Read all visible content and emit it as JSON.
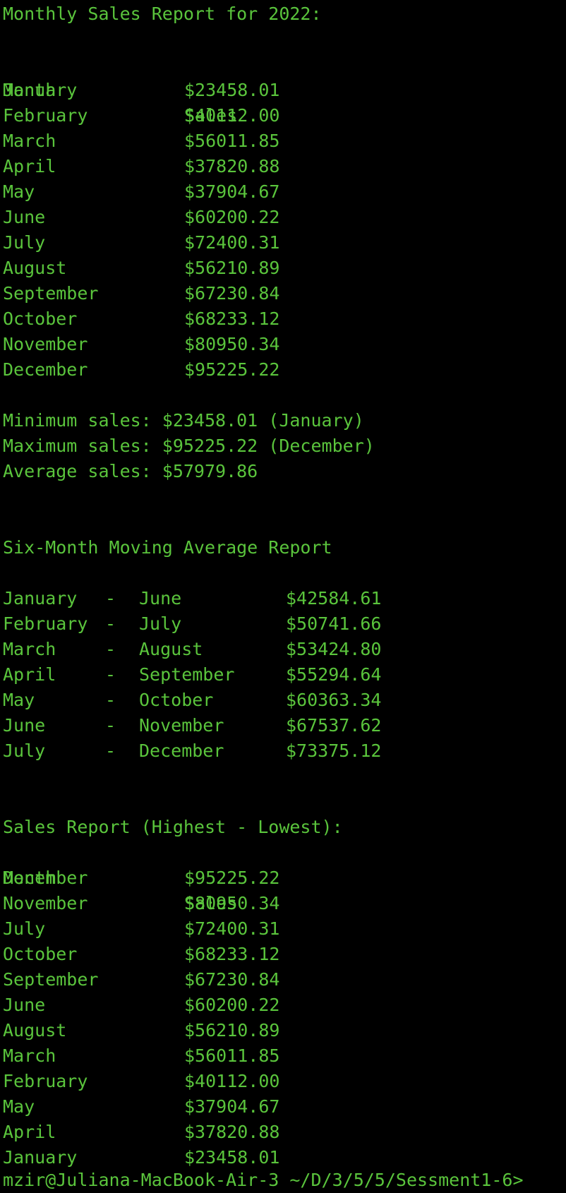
{
  "colors": {
    "background": "#000000",
    "text": "#5ac43c"
  },
  "monthly": {
    "title": "Monthly Sales Report for 2022:",
    "header_month": "Month",
    "header_sales": "Sales",
    "rows": [
      {
        "month": "January",
        "sales": "$23458.01"
      },
      {
        "month": "February",
        "sales": "$40112.00"
      },
      {
        "month": "March",
        "sales": "$56011.85"
      },
      {
        "month": "April",
        "sales": "$37820.88"
      },
      {
        "month": "May",
        "sales": "$37904.67"
      },
      {
        "month": "June",
        "sales": "$60200.22"
      },
      {
        "month": "July",
        "sales": "$72400.31"
      },
      {
        "month": "August",
        "sales": "$56210.89"
      },
      {
        "month": "September",
        "sales": "$67230.84"
      },
      {
        "month": "October",
        "sales": "$68233.12"
      },
      {
        "month": "November",
        "sales": "$80950.34"
      },
      {
        "month": "December",
        "sales": "$95225.22"
      }
    ],
    "min_line": "Minimum sales: $23458.01 (January)",
    "max_line": "Maximum sales: $95225.22 (December)",
    "avg_line": "Average sales: $57979.86"
  },
  "moving_average": {
    "title": "Six-Month Moving Average Report",
    "rows": [
      {
        "start": "January",
        "dash": "-",
        "end": "June",
        "value": "$42584.61"
      },
      {
        "start": "February",
        "dash": "-",
        "end": "July",
        "value": "$50741.66"
      },
      {
        "start": "March",
        "dash": "-",
        "end": "August",
        "value": "$53424.80"
      },
      {
        "start": "April",
        "dash": "-",
        "end": "September",
        "value": "$55294.64"
      },
      {
        "start": "May",
        "dash": "-",
        "end": "October",
        "value": "$60363.34"
      },
      {
        "start": "June",
        "dash": "-",
        "end": "November",
        "value": "$67537.62"
      },
      {
        "start": "July",
        "dash": "-",
        "end": "December",
        "value": "$73375.12"
      }
    ]
  },
  "sorted": {
    "title": "Sales Report (Highest - Lowest):",
    "header_month": "Month",
    "header_sales": "Sales",
    "rows": [
      {
        "month": "December",
        "sales": "$95225.22"
      },
      {
        "month": "November",
        "sales": "$80950.34"
      },
      {
        "month": "July",
        "sales": "$72400.31"
      },
      {
        "month": "October",
        "sales": "$68233.12"
      },
      {
        "month": "September",
        "sales": "$67230.84"
      },
      {
        "month": "June",
        "sales": "$60200.22"
      },
      {
        "month": "August",
        "sales": "$56210.89"
      },
      {
        "month": "March",
        "sales": "$56011.85"
      },
      {
        "month": "February",
        "sales": "$40112.00"
      },
      {
        "month": "May",
        "sales": "$37904.67"
      },
      {
        "month": "April",
        "sales": "$37820.88"
      },
      {
        "month": "January",
        "sales": "$23458.01"
      }
    ]
  },
  "prompt": "mzir@Juliana-MacBook-Air-3 ~/D/3/5/5/Sessment1-6>"
}
